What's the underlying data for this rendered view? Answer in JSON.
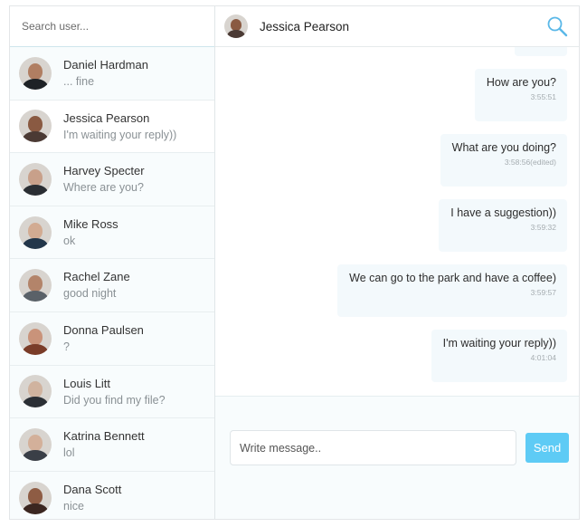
{
  "search": {
    "placeholder": "Search user..."
  },
  "contacts": [
    {
      "name": "Daniel Hardman",
      "last": "... fine",
      "active": false,
      "skin": "#b07e62",
      "shirt": "#1e2226"
    },
    {
      "name": "Jessica Pearson",
      "last": "I'm waiting your reply))",
      "active": true,
      "skin": "#8a5a42",
      "shirt": "#4b3a34"
    },
    {
      "name": "Harvey Specter",
      "last": "Where are you?",
      "active": false,
      "skin": "#c8a08a",
      "shirt": "#2a2e33"
    },
    {
      "name": "Mike Ross",
      "last": "ok",
      "active": false,
      "skin": "#d2ab92",
      "shirt": "#22364a"
    },
    {
      "name": "Rachel Zane",
      "last": "good night",
      "active": false,
      "skin": "#b3846a",
      "shirt": "#5a6168"
    },
    {
      "name": "Donna Paulsen",
      "last": "?",
      "active": false,
      "skin": "#c9937a",
      "shirt": "#7a3c28"
    },
    {
      "name": "Louis Litt",
      "last": "Did you find my file?",
      "active": false,
      "skin": "#d0b39f",
      "shirt": "#2b2f35"
    },
    {
      "name": "Katrina Bennett",
      "last": "lol",
      "active": false,
      "skin": "#d3b09a",
      "shirt": "#3a3f47"
    },
    {
      "name": "Dana Scott",
      "last": "nice",
      "active": false,
      "skin": "#8e5c44",
      "shirt": "#3b2620"
    }
  ],
  "chat": {
    "title": "Jessica Pearson",
    "messages": [
      {
        "text": "",
        "time": ""
      },
      {
        "text": "How are you?",
        "time": "3:55:51"
      },
      {
        "text": "What are you doing?",
        "time": "3:58:56(edited)"
      },
      {
        "text": "I have a suggestion))",
        "time": "3:59:32"
      },
      {
        "text": "We can go to the park and have a coffee)",
        "time": "3:59:57"
      },
      {
        "text": "I'm waiting your reply))",
        "time": "4:01:04"
      }
    ]
  },
  "composer": {
    "placeholder": "Write message..",
    "send_label": "Send"
  },
  "colors": {
    "accent": "#5ecbf5",
    "bubble": "#f3f9fc",
    "search_icon": "#5ab8e8"
  },
  "icons": {
    "header_search": "search-icon"
  }
}
